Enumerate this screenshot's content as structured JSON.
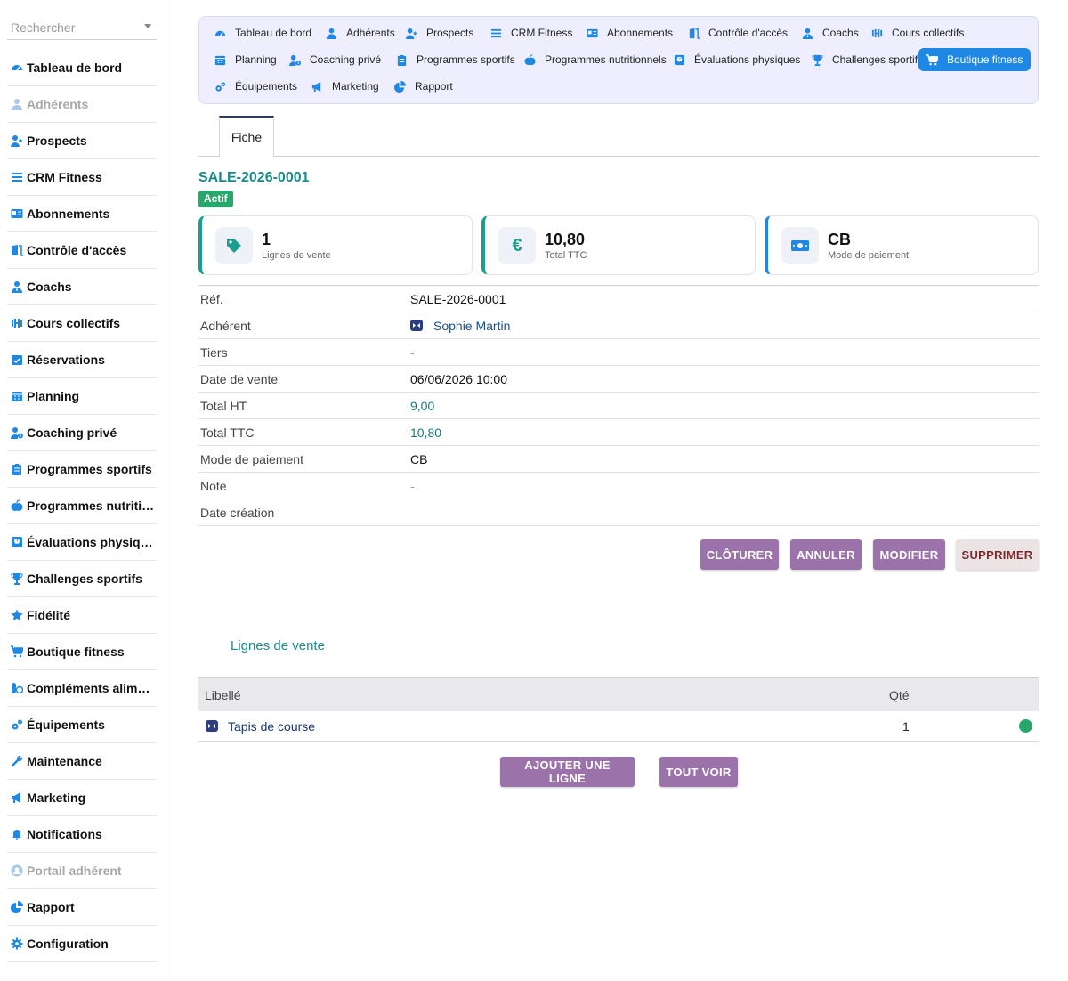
{
  "search": {
    "placeholder": "Rechercher"
  },
  "sidebar": {
    "items": [
      {
        "label": "Tableau de bord",
        "icon": "dashboard-icon",
        "enabled": true
      },
      {
        "label": "Adhérents",
        "icon": "user-icon",
        "enabled": false
      },
      {
        "label": "Prospects",
        "icon": "user-plus-icon",
        "enabled": true
      },
      {
        "label": "CRM Fitness",
        "icon": "list-icon",
        "enabled": true
      },
      {
        "label": "Abonnements",
        "icon": "id-card-icon",
        "enabled": true
      },
      {
        "label": "Contrôle d'accès",
        "icon": "door-icon",
        "enabled": true
      },
      {
        "label": "Coachs",
        "icon": "user-tie-icon",
        "enabled": true
      },
      {
        "label": "Cours collectifs",
        "icon": "dumbbell-icon",
        "enabled": true
      },
      {
        "label": "Réservations",
        "icon": "calendar-check-icon",
        "enabled": true
      },
      {
        "label": "Planning",
        "icon": "calendar-icon",
        "enabled": true
      },
      {
        "label": "Coaching privé",
        "icon": "user-clock-icon",
        "enabled": true
      },
      {
        "label": "Programmes sportifs",
        "icon": "clipboard-icon",
        "enabled": true
      },
      {
        "label": "Programmes nutritio…",
        "icon": "apple-icon",
        "enabled": true
      },
      {
        "label": "Évaluations physiques",
        "icon": "weight-icon",
        "enabled": true
      },
      {
        "label": "Challenges sportifs",
        "icon": "trophy-icon",
        "enabled": true
      },
      {
        "label": "Fidélité",
        "icon": "star-icon",
        "enabled": true
      },
      {
        "label": "Boutique fitness",
        "icon": "cart-icon",
        "enabled": true
      },
      {
        "label": "Compléments alime…",
        "icon": "pills-icon",
        "enabled": true
      },
      {
        "label": "Équipements",
        "icon": "cogs-icon",
        "enabled": true
      },
      {
        "label": "Maintenance",
        "icon": "wrench-icon",
        "enabled": true
      },
      {
        "label": "Marketing",
        "icon": "megaphone-icon",
        "enabled": true
      },
      {
        "label": "Notifications",
        "icon": "bell-icon",
        "enabled": true
      },
      {
        "label": "Portail adhérent",
        "icon": "user-circle-icon",
        "enabled": false
      },
      {
        "label": "Rapport",
        "icon": "pie-chart-icon",
        "enabled": true
      },
      {
        "label": "Configuration",
        "icon": "gear-icon",
        "enabled": true
      }
    ]
  },
  "topnav": {
    "items": [
      {
        "label": "Tableau de bord",
        "icon": "dashboard-icon"
      },
      {
        "label": "Adhérents",
        "icon": "user-icon"
      },
      {
        "label": "Prospects",
        "icon": "user-plus-icon"
      },
      {
        "label": "CRM Fitness",
        "icon": "list-icon"
      },
      {
        "label": "Abonnements",
        "icon": "id-card-icon"
      },
      {
        "label": "Contrôle d'accès",
        "icon": "door-icon"
      },
      {
        "label": "Coachs",
        "icon": "user-tie-icon"
      },
      {
        "label": "Cours collectifs",
        "icon": "dumbbell-icon"
      },
      {
        "label": "Planning",
        "icon": "calendar-icon"
      },
      {
        "label": "Coaching privé",
        "icon": "user-clock-icon"
      },
      {
        "label": "Programmes sportifs",
        "icon": "clipboard-icon"
      },
      {
        "label": "Programmes nutritionnels",
        "icon": "apple-icon"
      },
      {
        "label": "Évaluations physiques",
        "icon": "weight-icon"
      },
      {
        "label": "Challenges sportifs",
        "icon": "trophy-icon"
      },
      {
        "label": "Boutique fitness",
        "icon": "cart-icon",
        "active": true
      },
      {
        "label": "Équipements",
        "icon": "cogs-icon"
      },
      {
        "label": "Marketing",
        "icon": "megaphone-icon"
      },
      {
        "label": "Rapport",
        "icon": "pie-chart-icon"
      }
    ]
  },
  "tabs": [
    {
      "label": "Fiche",
      "active": true
    }
  ],
  "record": {
    "ref": "SALE-2026-0001",
    "status": "Actif"
  },
  "cards": [
    {
      "value": "1",
      "label": "Lignes de vente",
      "icon": "tag-icon",
      "accent": "#1a9e8d"
    },
    {
      "value": "10,80",
      "label": "Total TTC",
      "icon": "euro-icon",
      "accent": "#1a9e8d"
    },
    {
      "value": "CB",
      "label": "Mode de paiement",
      "icon": "money-bill-icon",
      "accent": "#1f88e5"
    }
  ],
  "details": [
    {
      "key": "Réf.",
      "value": "SALE-2026-0001",
      "style": "plain"
    },
    {
      "key": "Adhérent",
      "value": "Sophie Martin",
      "style": "link",
      "icon": "avatar-icon"
    },
    {
      "key": "Tiers",
      "value": "-",
      "style": "dash"
    },
    {
      "key": "Date de vente",
      "value": "06/06/2026 10:00",
      "style": "plain"
    },
    {
      "key": "Total HT",
      "value": "9,00",
      "style": "teal"
    },
    {
      "key": "Total TTC",
      "value": "10,80",
      "style": "teal"
    },
    {
      "key": "Mode de paiement",
      "value": "CB",
      "style": "plain"
    },
    {
      "key": "Note",
      "value": "-",
      "style": "dash"
    },
    {
      "key": "Date création",
      "value": "",
      "style": "plain"
    }
  ],
  "actions": {
    "close": "CLÔTURER",
    "cancel": "ANNULER",
    "edit": "MODIFIER",
    "delete": "SUPPRIMER"
  },
  "lines": {
    "title": "Lignes de vente",
    "headers": {
      "label": "Libellé",
      "qty": "Qté"
    },
    "rows": [
      {
        "label": "Tapis de course",
        "qty": "1",
        "status_color": "#26a86a"
      }
    ],
    "add": "AJOUTER UNE LIGNE",
    "see_all": "TOUT VOIR"
  },
  "colors": {
    "accent": "#1f88e5",
    "button": "#9b72aa",
    "teal": "#1a8a8a",
    "nav_bg": "#eeeefe"
  }
}
